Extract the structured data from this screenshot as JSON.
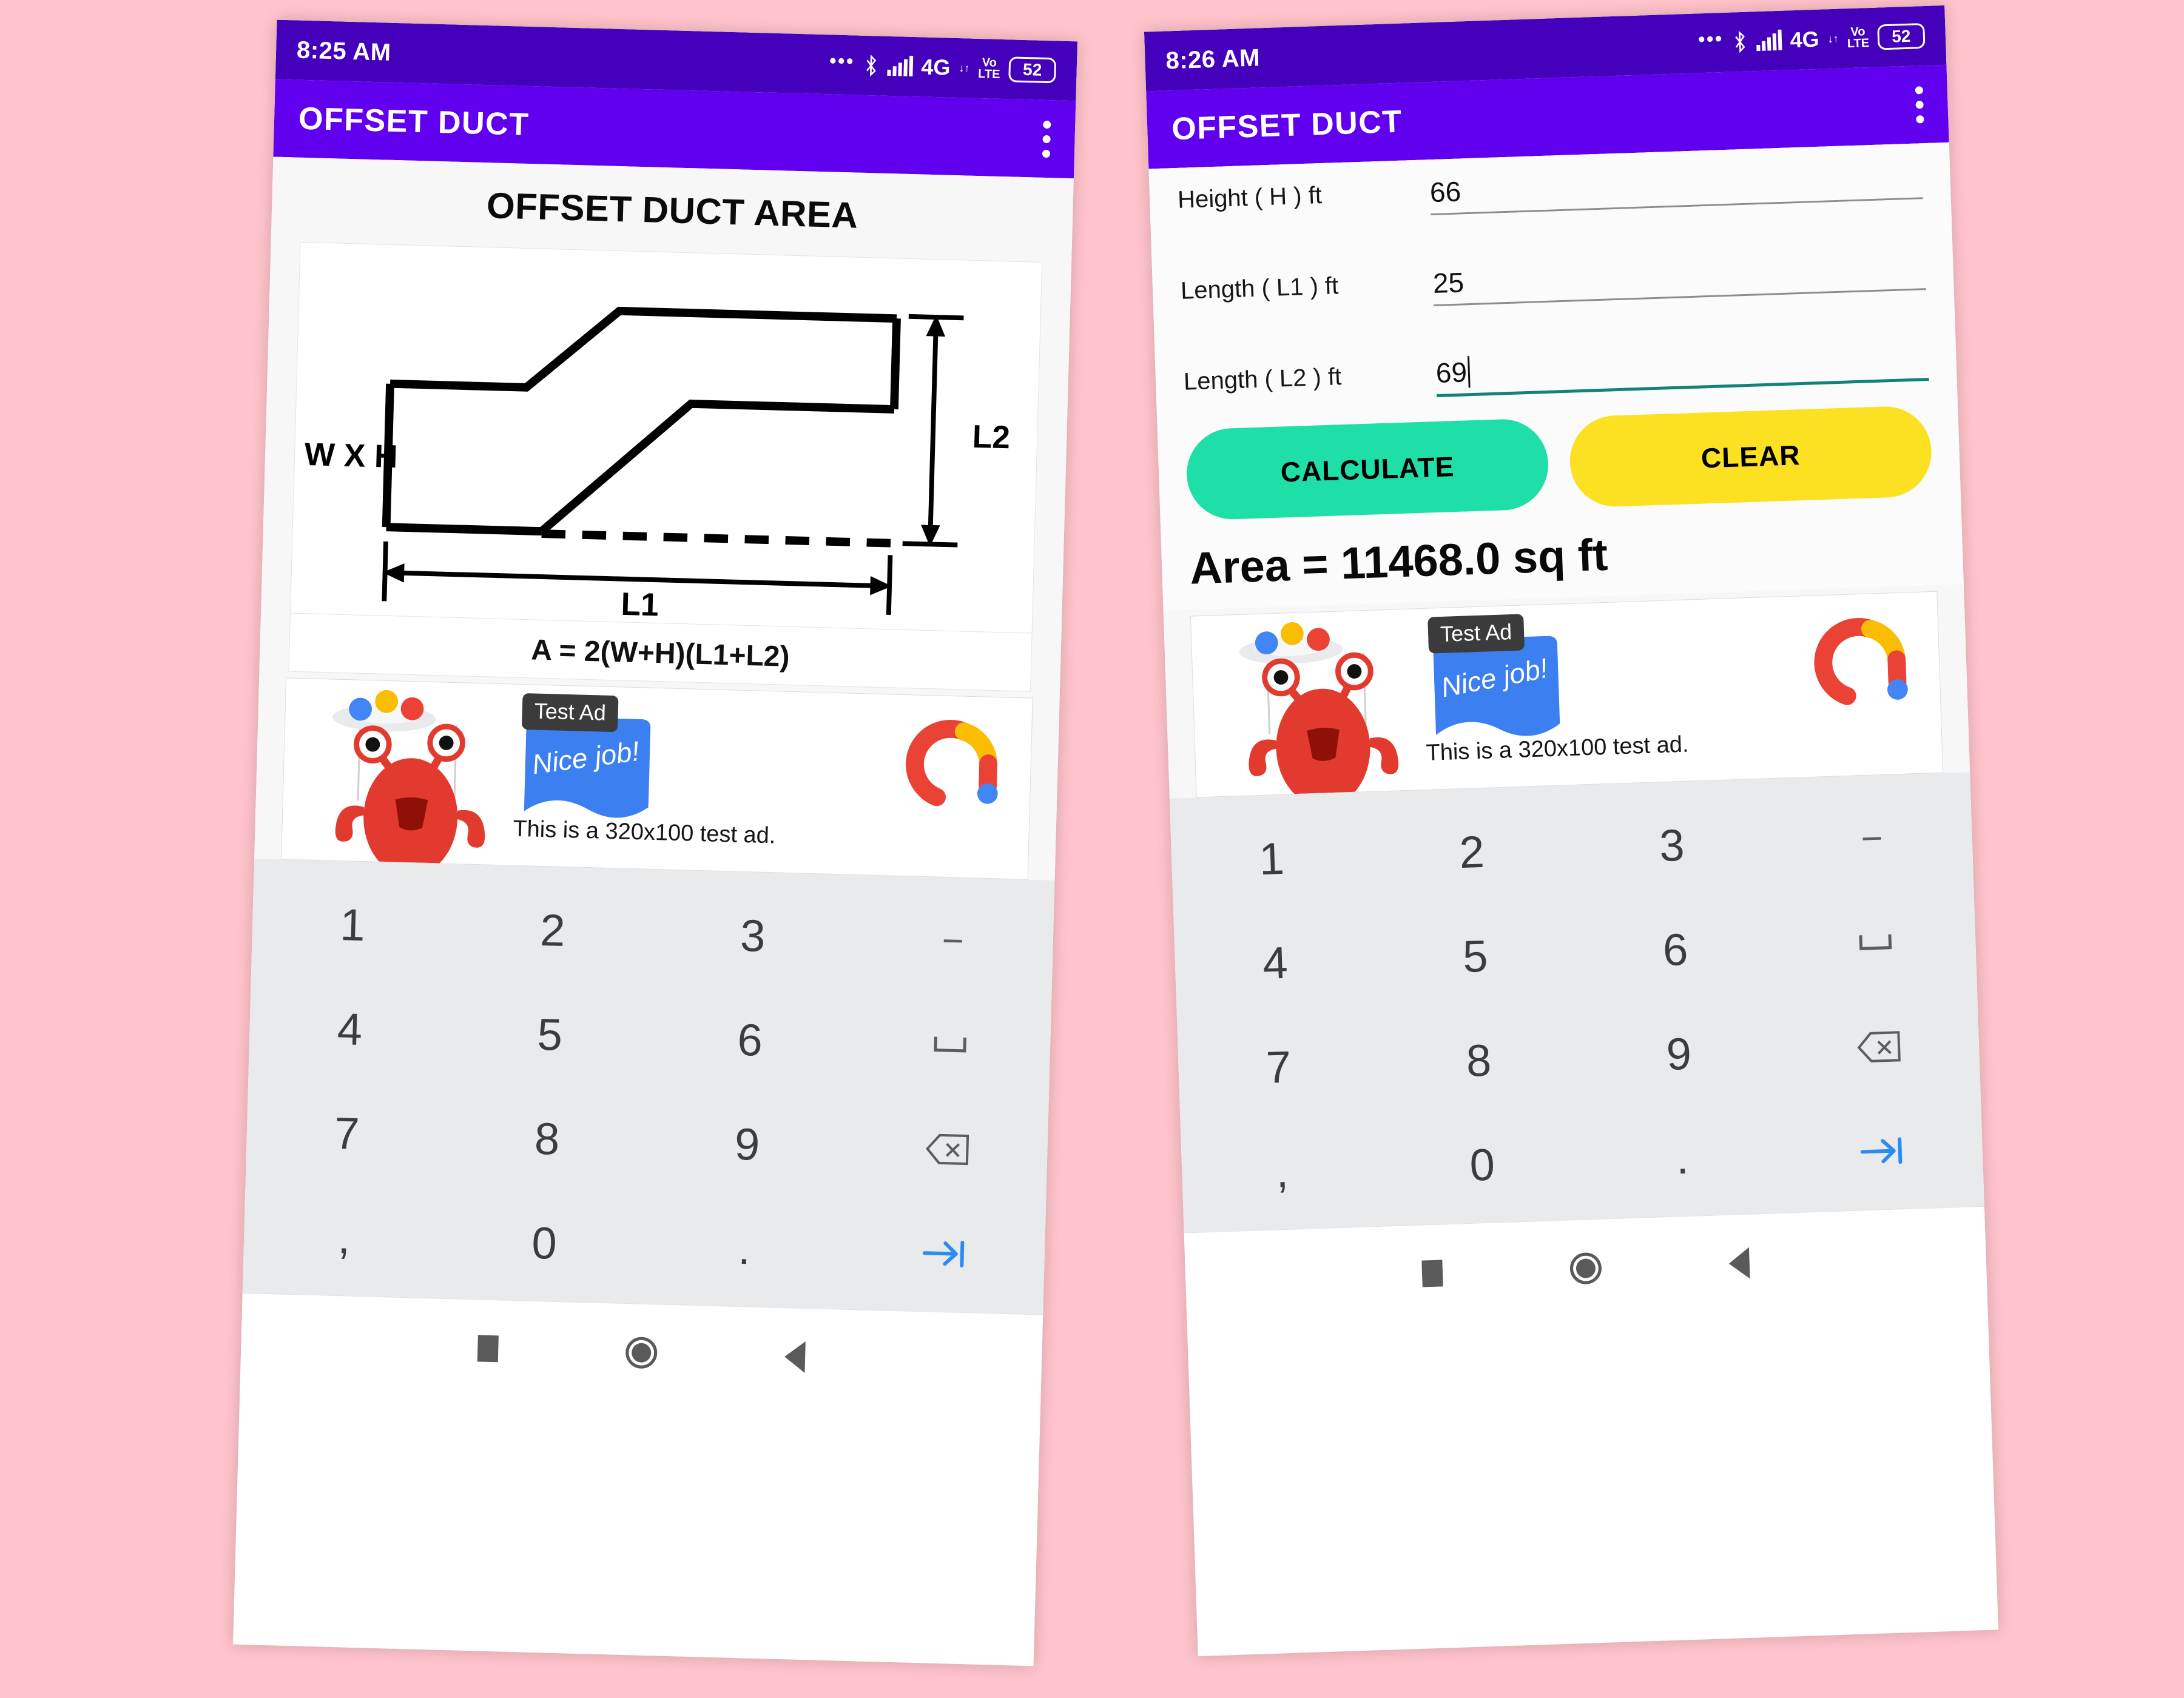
{
  "background_color": "#ffc3cb",
  "theme": {
    "appbar_purple": "#6100ee",
    "statusbar_purple": "#4400ba",
    "calculate_green": "#1fdfa8",
    "clear_yellow": "#fbe122",
    "focus_teal": "#128376"
  },
  "phones": [
    {
      "id": "left",
      "statusbar": {
        "time": "8:25 AM",
        "dots": "•••",
        "network": "4G",
        "volte_top": "Vo",
        "volte_bottom": "LTE",
        "battery": "52"
      },
      "appbar": {
        "title": "OFFSET DUCT",
        "menu_icon": "kebab-menu-icon"
      },
      "page_title": "OFFSET DUCT AREA",
      "diagram": {
        "label_wh": "W X H",
        "label_l1": "L1",
        "label_l2": "L2"
      },
      "formula": "A = 2(W+H)(L1+L2)"
    },
    {
      "id": "right",
      "statusbar": {
        "time": "8:26 AM",
        "dots": "•••",
        "network": "4G",
        "volte_top": "Vo",
        "volte_bottom": "LTE",
        "battery": "52"
      },
      "appbar": {
        "title": "OFFSET DUCT",
        "menu_icon": "kebab-menu-icon"
      },
      "fields": [
        {
          "label": "Height ( H ) ft",
          "value": "66",
          "focused": false,
          "clipped": true
        },
        {
          "label": "Length ( L1 ) ft",
          "value": "25",
          "focused": false,
          "clipped": false
        },
        {
          "label": "Length ( L2 ) ft",
          "value": "69",
          "focused": true,
          "clipped": false
        }
      ],
      "buttons": {
        "calculate": "CALCULATE",
        "clear": "CLEAR"
      },
      "result": "Area = 11468.0 sq ft"
    }
  ],
  "ad": {
    "badge": "Test Ad",
    "speech_bubble": "Nice job!",
    "caption": "This is a 320x100 test ad.",
    "logo": "admob-logo-icon"
  },
  "keyboard": {
    "rows": [
      [
        "1",
        "2",
        "3",
        "minus"
      ],
      [
        "4",
        "5",
        "6",
        "space"
      ],
      [
        "7",
        "8",
        "9",
        "backspace"
      ],
      [
        ",",
        "0",
        ".",
        "tab"
      ]
    ],
    "symbols": {
      "minus": "−",
      "space": "␣",
      "backspace": "backspace-icon",
      "tab": "tab-icon"
    }
  },
  "navbar": {
    "recents": "square-recents-icon",
    "home": "circle-home-icon",
    "back": "triangle-back-icon"
  }
}
